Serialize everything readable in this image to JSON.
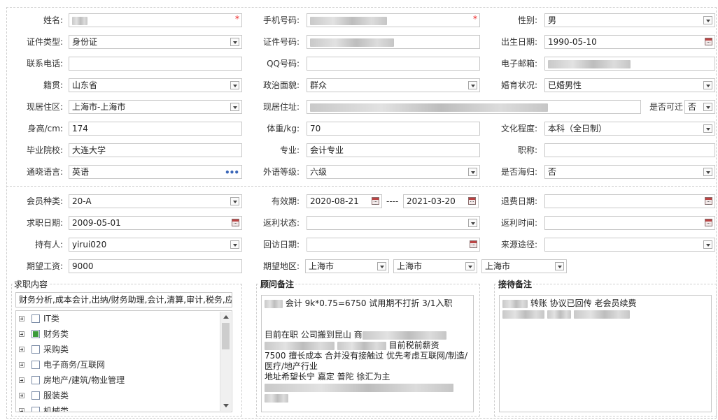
{
  "form": {
    "name": {
      "label": "姓名:",
      "value": ""
    },
    "mobile": {
      "label": "手机号码:",
      "value": ""
    },
    "gender": {
      "label": "性别:",
      "value": "男"
    },
    "id_type": {
      "label": "证件类型:",
      "value": "身份证"
    },
    "id_number": {
      "label": "证件号码:",
      "value": ""
    },
    "birthday": {
      "label": "出生日期:",
      "value": "1990-05-10"
    },
    "phone": {
      "label": "联系电话:",
      "value": ""
    },
    "qq": {
      "label": "QQ号码:",
      "value": ""
    },
    "email": {
      "label": "电子邮箱:",
      "value": ""
    },
    "native_place": {
      "label": "籍贯:",
      "value": "山东省"
    },
    "political": {
      "label": "政治面貌:",
      "value": "群众"
    },
    "marital": {
      "label": "婚育状况:",
      "value": "已婚男性"
    },
    "residence_area": {
      "label": "现居住区:",
      "value": "上海市-上海市"
    },
    "address": {
      "label": "现居住址:",
      "value": ""
    },
    "relocatable": {
      "label": "是否可迁",
      "value": "否"
    },
    "height": {
      "label": "身高/cm:",
      "value": "174"
    },
    "weight": {
      "label": "体重/kg:",
      "value": "70"
    },
    "education": {
      "label": "文化程度:",
      "value": "本科（全日制）"
    },
    "school": {
      "label": "毕业院校:",
      "value": "大连大学"
    },
    "major": {
      "label": "专业:",
      "value": "会计专业"
    },
    "title": {
      "label": "职称:",
      "value": ""
    },
    "language": {
      "label": "通晓语言:",
      "value": "英语"
    },
    "lang_level": {
      "label": "外语等级:",
      "value": "六级"
    },
    "overseas": {
      "label": "是否海归:",
      "value": "否"
    },
    "member_type": {
      "label": "会员种类:",
      "value": "20-A"
    },
    "valid_period": {
      "label": "有效期:",
      "from": "2020-08-21",
      "sep": "----",
      "to": "2021-03-20"
    },
    "refund_date": {
      "label": "退费日期:",
      "value": ""
    },
    "apply_date": {
      "label": "求职日期:",
      "value": "2009-05-01"
    },
    "rebate_status": {
      "label": "返利状态:",
      "value": ""
    },
    "rebate_time": {
      "label": "返利时间:",
      "value": ""
    },
    "holder": {
      "label": "持有人:",
      "value": "yirui020"
    },
    "visit_date": {
      "label": "回访日期:",
      "value": ""
    },
    "source": {
      "label": "来源途径:",
      "value": ""
    },
    "expected_salary": {
      "label": "期望工资:",
      "value": "9000"
    },
    "expected_area": {
      "label": "期望地区:",
      "values": [
        "上海市",
        "上海市",
        "上海市"
      ]
    }
  },
  "job_content": {
    "title": "求职内容",
    "summary": "财务分析,成本会计,出纳/财务助理,会计,清算,审计,税务,应",
    "tree": [
      {
        "label": "IT类",
        "checked": false
      },
      {
        "label": "财务类",
        "checked": true
      },
      {
        "label": "采购类",
        "checked": false
      },
      {
        "label": "电子商务/互联网",
        "checked": false
      },
      {
        "label": "房地产/建筑/物业管理",
        "checked": false
      },
      {
        "label": "服装类",
        "checked": false
      },
      {
        "label": "机械类",
        "checked": false
      }
    ]
  },
  "advisor_note": {
    "title": "顾问备注",
    "line1": "会计   9k*0.75=6750   试用期不打折      3/1入职",
    "line2": "目前在职   公司搬到昆山   商",
    "line3": "目前税前薪资",
    "line4": "7500   擅长成本  合并没有接触过   优先考虑互联网/制造/医疗/地产行业",
    "line5": "地址希望长宁  嘉定    普陀    徐汇为主"
  },
  "reception_note": {
    "title": "接待备注",
    "line1": "转账  协议已回传  老会员续费"
  }
}
